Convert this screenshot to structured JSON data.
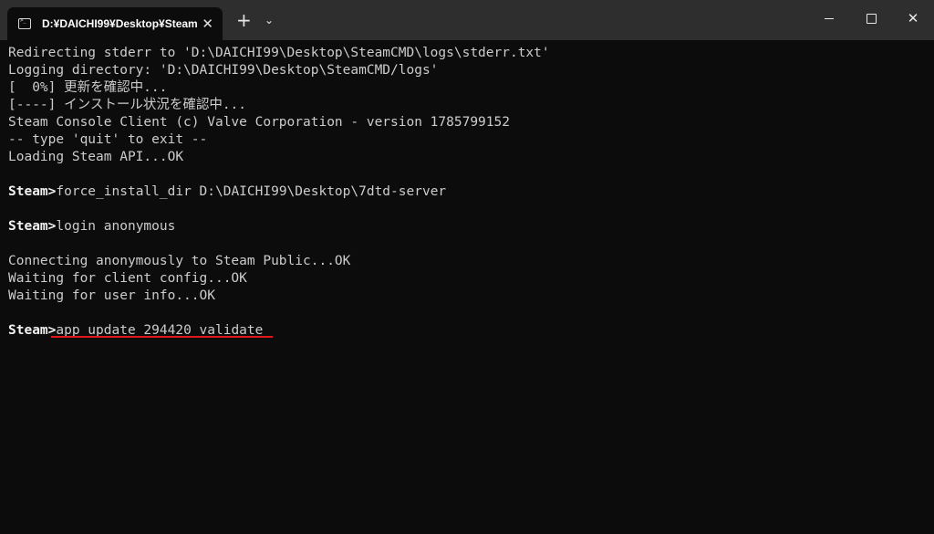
{
  "window": {
    "tab_title": "D:¥DAICHI99¥Desktop¥Steam",
    "tab_close_glyph": "✕",
    "new_tab_glyph": "+",
    "dropdown_glyph": "⌄",
    "close_glyph": "✕"
  },
  "terminal": {
    "lines": [
      "Redirecting stderr to 'D:\\DAICHI99\\Desktop\\SteamCMD\\logs\\stderr.txt'",
      "Logging directory: 'D:\\DAICHI99\\Desktop\\SteamCMD/logs'",
      "[  0%] 更新を確認中...",
      "[----] インストール状況を確認中...",
      "Steam Console Client (c) Valve Corporation - version 1785799152",
      "-- type 'quit' to exit --",
      "Loading Steam API...OK",
      "",
      "force_install_dir D:\\DAICHI99\\Desktop\\7dtd-server",
      "",
      "login anonymous",
      "",
      "Connecting anonymously to Steam Public...OK",
      "Waiting for client config...OK",
      "Waiting for user info...OK",
      "",
      "app_update 294420 validate"
    ],
    "prompt": "Steam>"
  },
  "colors": {
    "background": "#0c0c0c",
    "titlebar": "#2e2e2e",
    "text": "#cccccc",
    "annotation_underline": "#e0161b"
  }
}
